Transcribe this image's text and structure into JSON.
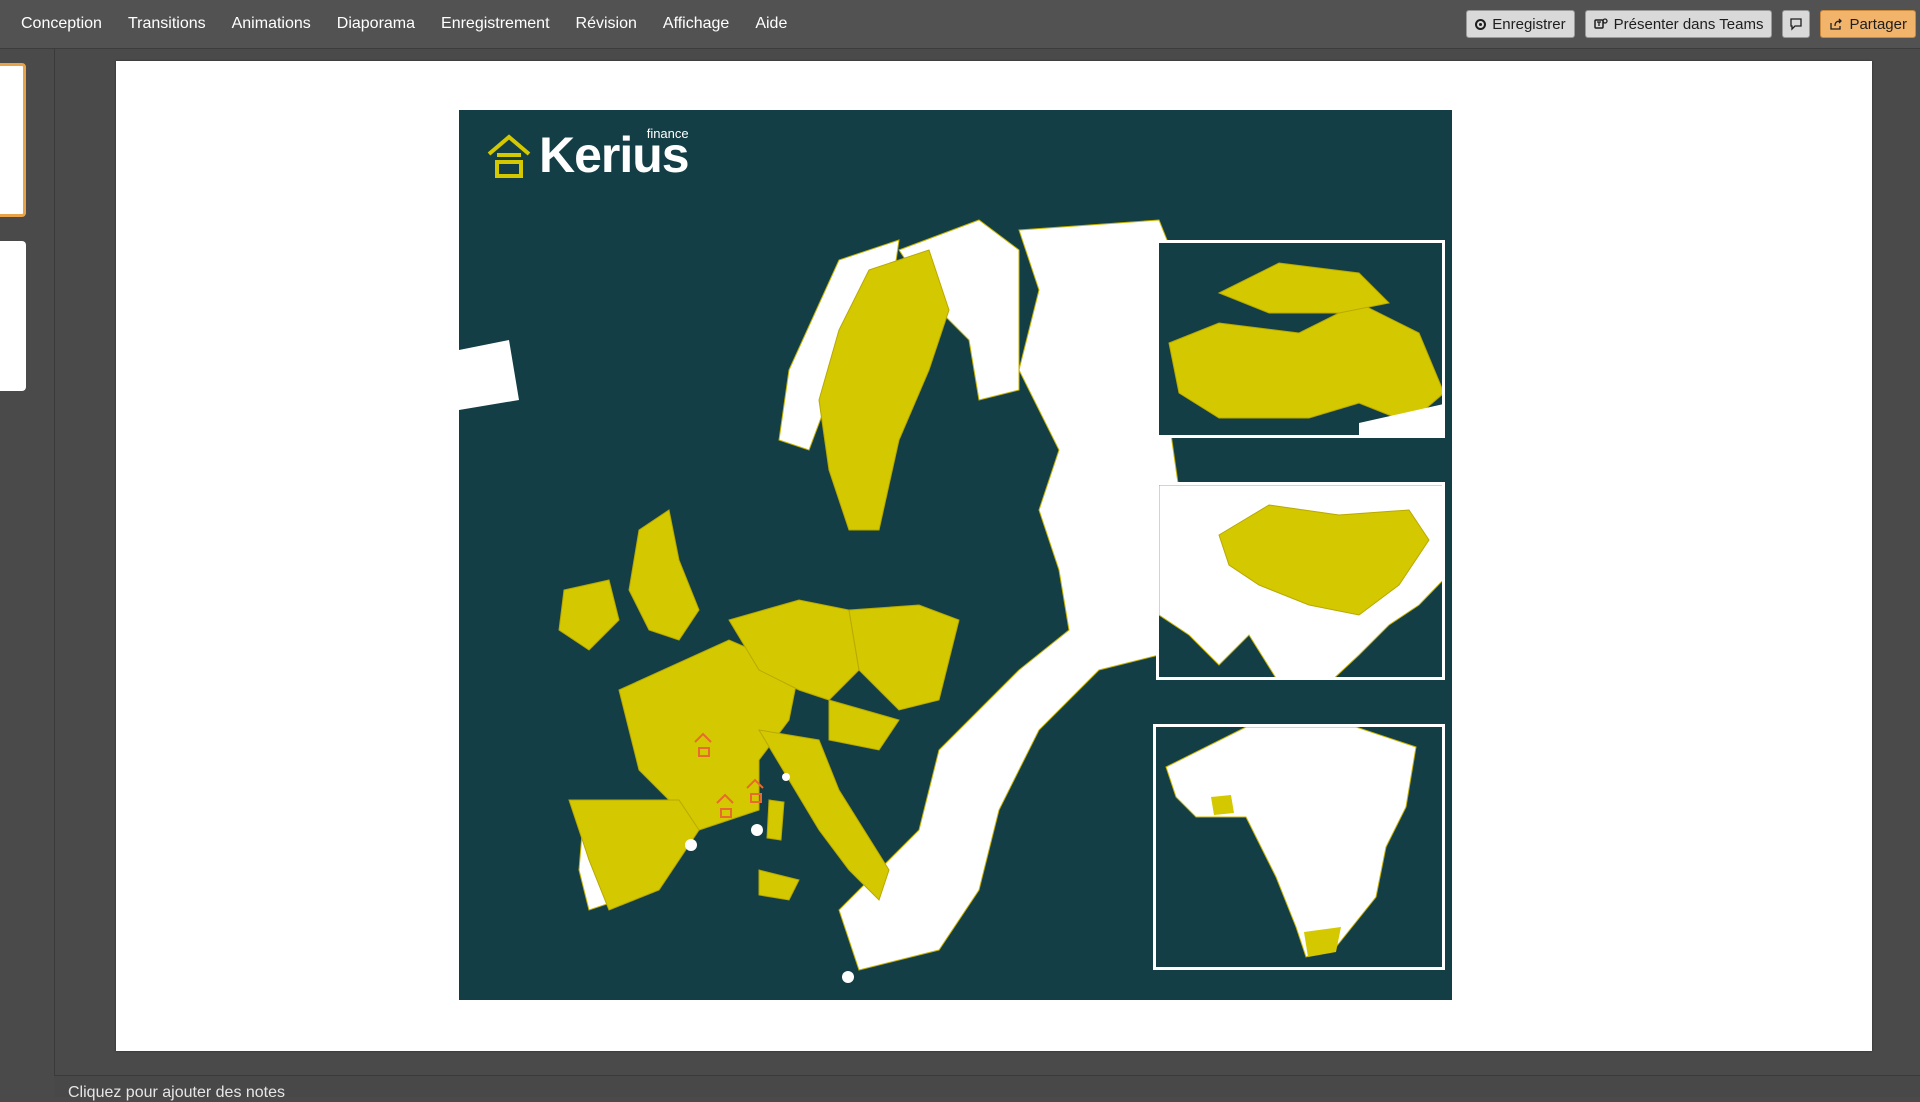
{
  "ribbon": {
    "tabs": [
      "Conception",
      "Transitions",
      "Animations",
      "Diaporama",
      "Enregistrement",
      "Révision",
      "Affichage",
      "Aide"
    ],
    "record_label": "Enregistrer",
    "teams_label": "Présenter dans Teams",
    "share_label": "Partager"
  },
  "slide": {
    "logo_text": "Kerius",
    "logo_sub": "finance",
    "highlight_color": "#d4c800",
    "sea_color": "#133e45"
  },
  "notes": {
    "placeholder": "Cliquez pour ajouter des notes"
  }
}
